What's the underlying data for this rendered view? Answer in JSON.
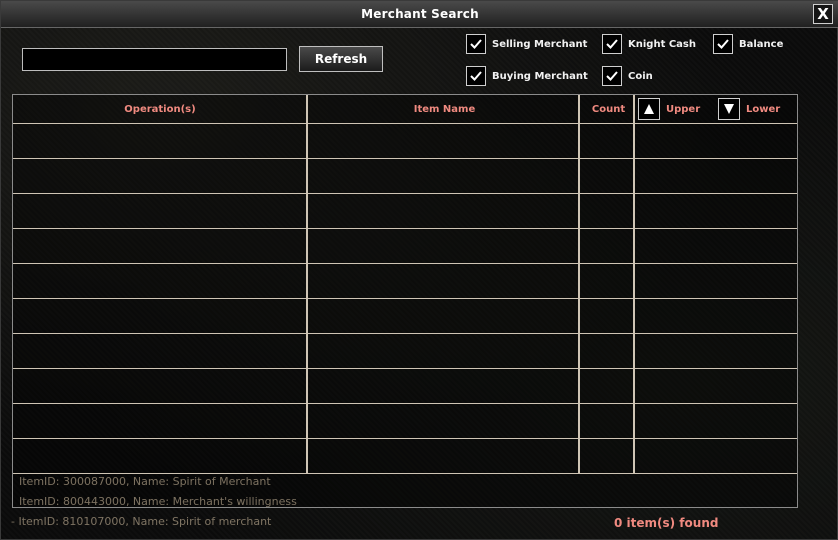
{
  "window": {
    "title": "Merchant Search",
    "close_label": "X"
  },
  "search": {
    "value": "",
    "placeholder": ""
  },
  "toolbar": {
    "refresh_label": "Refresh"
  },
  "filters": {
    "selling_merchant": {
      "label": "Selling Merchant",
      "checked": true
    },
    "buying_merchant": {
      "label": "Buying Merchant",
      "checked": true
    },
    "knight_cash": {
      "label": "Knight Cash",
      "checked": true
    },
    "coin": {
      "label": "Coin",
      "checked": true
    },
    "balance": {
      "label": "Balance",
      "checked": true
    }
  },
  "table": {
    "columns": {
      "operation": "Operation(s)",
      "item_name": "Item Name",
      "count": "Count"
    },
    "sort": {
      "upper_label": "Upper",
      "lower_label": "Lower"
    },
    "rows": []
  },
  "background_log": [
    "ItemID: 300087000, Name: Spirit of Merchant",
    "ItemID: 800443000, Name: Merchant's willingness",
    "- ItemID: 810107000, Name: Spirit of merchant"
  ],
  "status": {
    "found_text": "0 item(s) found"
  },
  "colors": {
    "header_text": "#f08a80",
    "status_text": "#f08a80",
    "grid_lines": "#cfc5b5"
  },
  "icons": {
    "close": "close-icon",
    "check": "check-icon",
    "upper": "triangle-up-icon",
    "lower": "triangle-down-icon"
  }
}
